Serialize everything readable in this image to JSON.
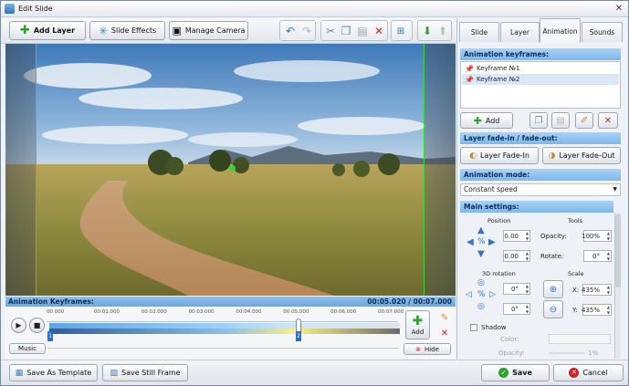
{
  "window": {
    "title": "Edit Slide",
    "close": "✕"
  },
  "toolbar": {
    "add_layer": "Add Layer",
    "slide_effects": "Slide Effects",
    "manage_camera": "Manage Camera"
  },
  "keyframes_bar": {
    "label": "Animation Keyframes:",
    "time": "00:05.020 / 00:07.000"
  },
  "timeline": {
    "ticks": [
      "00.000",
      "00:01.000",
      "00:02.000",
      "00:03.000",
      "00:04.000",
      "00:05.000",
      "00:06.000",
      "00:07.000"
    ],
    "markers": [
      "1",
      "2"
    ],
    "add_label": "Add",
    "music_label": "Music",
    "hide_label": "Hide"
  },
  "bottom": {
    "save_template": "Save As Template",
    "save_still": "Save Still Frame",
    "save": "Save",
    "cancel": "Cancel"
  },
  "tabs": [
    "Slide",
    "Layer",
    "Animation",
    "Sounds"
  ],
  "active_tab": "Animation",
  "animation": {
    "keyframes_title": "Animation keyframes:",
    "keyframes": [
      "Keyframe №1",
      "Keyframe №2"
    ],
    "add_label": "Add",
    "fade_title": "Layer fade-in / fade-out:",
    "fade_in": "Layer Fade-In",
    "fade_out": "Layer Fade-Out",
    "mode_title": "Animation mode:",
    "mode_value": "Constant speed",
    "main_title": "Main settings:",
    "position_label": "Position",
    "tools_label": "Tools",
    "pos_x": "0.00",
    "pos_y": "0.00",
    "opacity_label": "Opacity:",
    "opacity_value": "100%",
    "rotate_label": "Rotate:",
    "rotate_value": "0°",
    "rotation3d_label": "3D rotation",
    "scale_label": "Scale",
    "rot3d_x": "0°",
    "rot3d_y": "0°",
    "scale_x_label": "X:",
    "scale_x": "435%",
    "scale_y_label": "Y:",
    "scale_y": "435%",
    "shadow_label": "Shadow",
    "color_label": "Color:",
    "shadow_opacity_label": "Opacity:",
    "shadow_opacity_value": "1%"
  },
  "colors": {
    "accent": "#7db7ea",
    "frame_guide": "#3bd43b",
    "save_icon": "#2c9e2c",
    "cancel_icon": "#d32222"
  }
}
